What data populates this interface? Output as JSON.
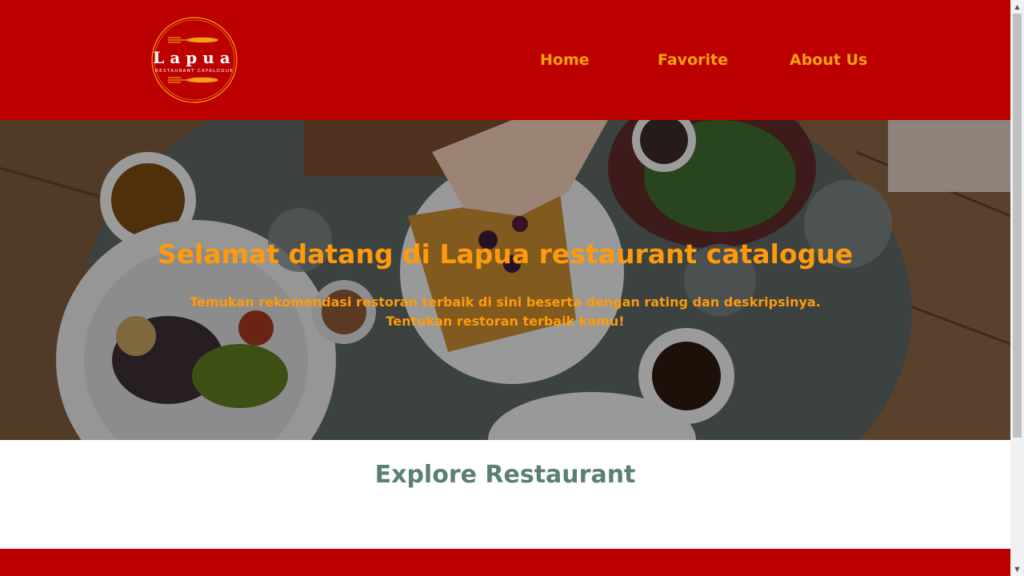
{
  "header": {
    "logo": {
      "name": "Lapua",
      "tagline": "RESTAURANT CATALOGUE",
      "icon": "fork-spoon-knife-logo"
    },
    "nav": {
      "home": "Home",
      "favorite": "Favorite",
      "about": "About Us"
    }
  },
  "hero": {
    "title": "Selamat datang di Lapua restaurant catalogue",
    "subtitle": "Temukan rekomendasi restoran terbaik di sini beserta dengan rating dan deskripsinya. Tentukan restoran terbaik kamu!",
    "image": "restaurant-table-food-photo"
  },
  "explore": {
    "title": "Explore Restaurant"
  },
  "colors": {
    "brand_red": "#bc0000",
    "accent_orange": "#f5a011",
    "explore_green": "#5a8070"
  },
  "scrollbar": {
    "up_icon": "scroll-up-arrow",
    "down_icon": "scroll-down-arrow"
  }
}
